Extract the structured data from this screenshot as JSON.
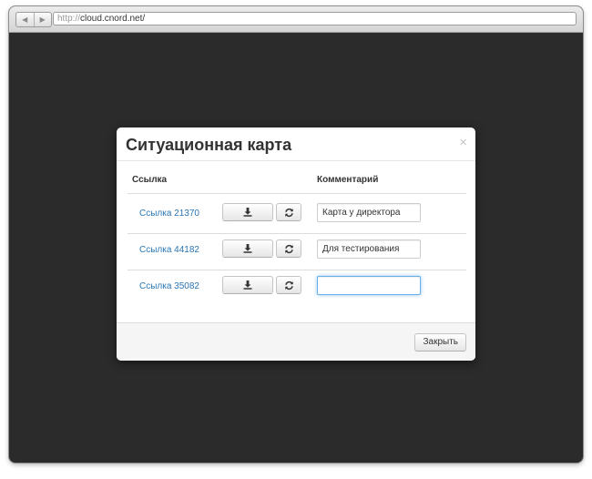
{
  "browser": {
    "back_icon": "◀",
    "forward_icon": "▶",
    "url_scheme": "http://",
    "url_host": "cloud.cnord.net/"
  },
  "modal": {
    "title": "Ситуационная карта",
    "close_symbol": "×",
    "columns": {
      "link": "Ссылка",
      "comment": "Комментарий"
    },
    "rows": [
      {
        "link_label": "Ссылка 21370",
        "comment": "Карта у директора"
      },
      {
        "link_label": "Ссылка 44182",
        "comment": "Для тестирования"
      },
      {
        "link_label": "Ссылка 35082",
        "comment": ""
      }
    ],
    "close_button": "Закрыть",
    "icons": {
      "download": "download-icon",
      "refresh": "refresh-icon"
    }
  }
}
